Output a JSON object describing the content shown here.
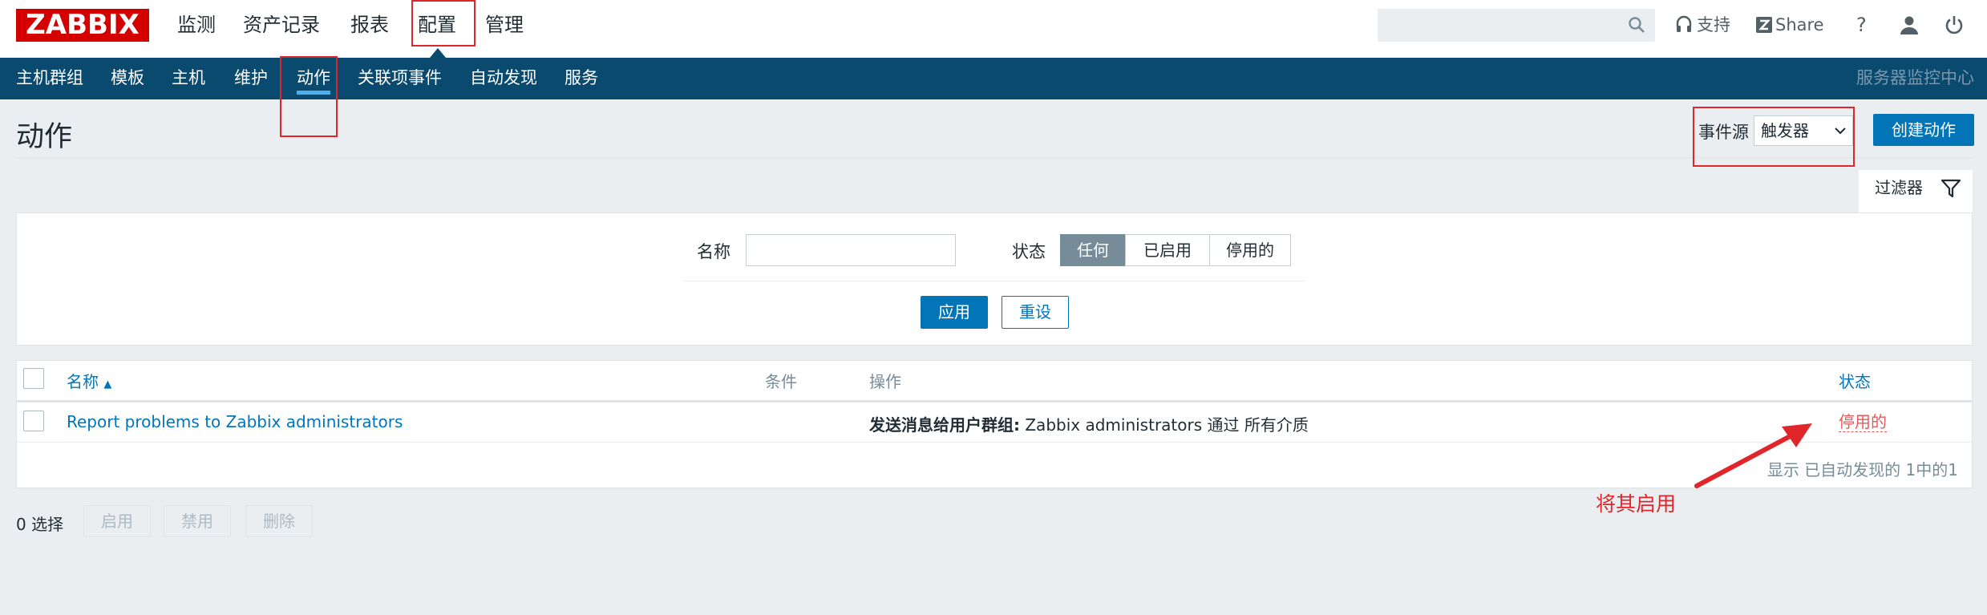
{
  "header": {
    "logo": "ZABBIX",
    "main_nav": [
      "监测",
      "资产记录",
      "报表",
      "配置",
      "管理"
    ],
    "search_placeholder": "",
    "support": "支持",
    "share": "Share",
    "help": "?"
  },
  "subnav": {
    "items": [
      "主机群组",
      "模板",
      "主机",
      "维护",
      "动作",
      "关联项事件",
      "自动发现",
      "服务"
    ],
    "active": "动作",
    "right_label": "服务器监控中心"
  },
  "page": {
    "title": "动作",
    "event_source_label": "事件源",
    "event_source_value": "触发器",
    "create_button": "创建动作"
  },
  "filter": {
    "tab_label": "过滤器",
    "name_label": "名称",
    "name_value": "",
    "status_label": "状态",
    "status_options": [
      "任何",
      "已启用",
      "停用的"
    ],
    "status_selected": "任何",
    "apply": "应用",
    "reset": "重设"
  },
  "table": {
    "headers": {
      "name": "名称",
      "sort_arrow": "▲",
      "conditions": "条件",
      "operations": "操作",
      "status": "状态"
    },
    "rows": [
      {
        "name": "Report problems to Zabbix administrators",
        "conditions": "",
        "operation_bold": "发送消息给用户群组:",
        "operation_rest": " Zabbix administrators 通过 所有介质",
        "status": "停用的"
      }
    ],
    "stats": "显示 已自动发现的 1中的1"
  },
  "footer": {
    "selected": "0 选择",
    "buttons": [
      "启用",
      "禁用",
      "删除"
    ]
  },
  "annotation": {
    "text": "将其启用",
    "color": "#e0262b"
  }
}
